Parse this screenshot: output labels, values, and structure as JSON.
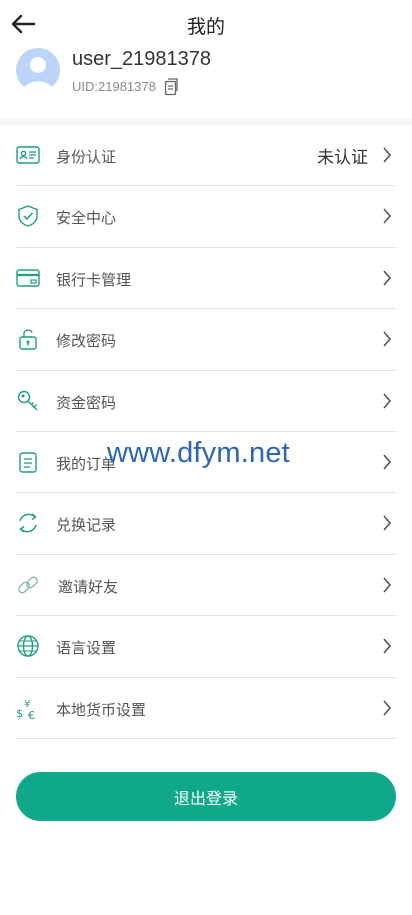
{
  "header": {
    "title": "我的"
  },
  "profile": {
    "username": "user_21981378",
    "uid": "UID:21981378"
  },
  "menu": {
    "items": [
      {
        "icon": "id-card-icon",
        "label": "身份认证",
        "value": "未认证"
      },
      {
        "icon": "shield-icon",
        "label": "安全中心",
        "value": ""
      },
      {
        "icon": "bank-card-icon",
        "label": "银行卡管理",
        "value": ""
      },
      {
        "icon": "lock-icon",
        "label": "修改密码",
        "value": ""
      },
      {
        "icon": "key-icon",
        "label": "资金密码",
        "value": ""
      },
      {
        "icon": "order-icon",
        "label": "我的订单",
        "value": ""
      },
      {
        "icon": "exchange-icon",
        "label": "兑换记录",
        "value": ""
      },
      {
        "icon": "link-icon",
        "label": "邀请好友",
        "value": ""
      },
      {
        "icon": "globe-icon",
        "label": "语言设置",
        "value": ""
      },
      {
        "icon": "currency-icon",
        "label": "本地货币设置",
        "value": ""
      }
    ]
  },
  "watermark": "www.dfym.net",
  "logout_label": "退出登录",
  "colors": {
    "accent": "#10a88b",
    "icon": "#1f9e84"
  }
}
